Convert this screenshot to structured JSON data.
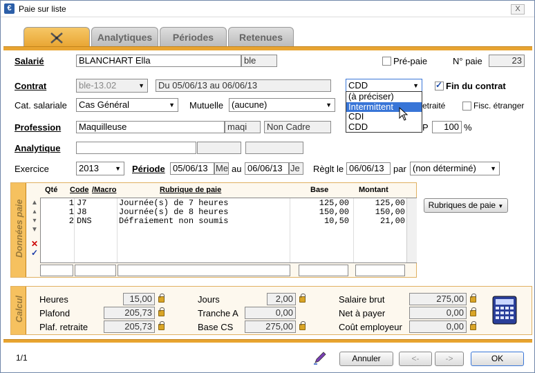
{
  "window": {
    "title": "Paie sur liste",
    "close": "X"
  },
  "tabs": [
    {
      "label": ""
    },
    {
      "label": "Analytiques"
    },
    {
      "label": "Périodes"
    },
    {
      "label": "Retenues"
    }
  ],
  "header": {
    "salarie_label": "Salarié",
    "salarie_name": "BLANCHART Ella",
    "salarie_code": "ble",
    "prepaie_label": "Pré-paie",
    "npaie_label": "N° paie",
    "npaie_value": "23",
    "contrat_label": "Contrat",
    "contrat_code": "ble-13.02",
    "contrat_dates": "Du 05/06/13 au 06/06/13",
    "contrat_type": "CDD",
    "fin_contrat_label": "Fin du contrat",
    "cat_label": "Cat. salariale",
    "cat_value": "Cas Général",
    "mutuelle_label": "Mutuelle",
    "mutuelle_value": "(aucune)",
    "retraite_label": "etraité",
    "fisc_label": "Fisc. étranger",
    "profession_label": "Profession",
    "profession_value": "Maquilleuse",
    "profession_code": "maqi",
    "profession_status": "Non Cadre",
    "p_label": "P",
    "p_value": "100",
    "pct": "%",
    "analytique_label": "Analytique",
    "exercice_label": "Exercice",
    "exercice_value": "2013",
    "periode_label": "Période",
    "periode_start": "05/06/13",
    "periode_start_day": "Me",
    "au_label": "au",
    "periode_end": "06/06/13",
    "periode_end_day": "Je",
    "reglt_label": "Règlt le",
    "reglt_date": "06/06/13",
    "par_label": "par",
    "par_value": "(non déterminé)"
  },
  "dropdown": {
    "options": [
      "(à préciser)",
      "Intermittent",
      "CDI",
      "CDD"
    ],
    "highlighted": 1
  },
  "donnees": {
    "side_label": "Données paie",
    "headers": {
      "qte": "Qté",
      "code": "Code",
      "macro": "/Macro",
      "rubrique": "Rubrique de paie",
      "base": "Base",
      "montant": "Montant"
    },
    "rows": [
      {
        "qte": "1",
        "code": "J7",
        "rubrique": "Journée(s) de 7 heures",
        "base": "125,00",
        "montant": "125,00"
      },
      {
        "qte": "1",
        "code": "J8",
        "rubrique": "Journée(s) de 8 heures",
        "base": "150,00",
        "montant": "150,00"
      },
      {
        "qte": "2",
        "code": "DNS",
        "rubrique": "Défraiement non soumis",
        "base": "10,50",
        "montant": "21,00"
      }
    ],
    "rubriques_button": "Rubriques de paie"
  },
  "calcul": {
    "side_label": "Calcul",
    "heures_label": "Heures",
    "heures": "15,00",
    "plafond_label": "Plafond",
    "plafond": "205,73",
    "plafret_label": "Plaf. retraite",
    "plafret": "205,73",
    "jours_label": "Jours",
    "jours": "2,00",
    "trancheA_label": "Tranche A",
    "trancheA": "0,00",
    "basecs_label": "Base CS",
    "basecs": "275,00",
    "brut_label": "Salaire brut",
    "brut": "275,00",
    "net_label": "Net à payer",
    "net": "0,00",
    "cout_label": "Coût employeur",
    "cout": "0,00"
  },
  "footer": {
    "page": "1/1",
    "annuler": "Annuler",
    "prev": "<-",
    "next": "->",
    "ok": "OK"
  }
}
